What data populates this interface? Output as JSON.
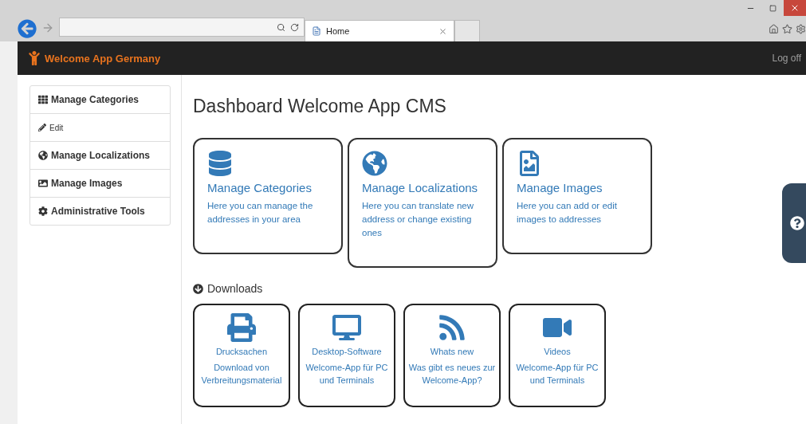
{
  "browser": {
    "tab_title": "Home"
  },
  "app": {
    "brand": "Welcome App Germany",
    "logoff": "Log off"
  },
  "sidebar": {
    "items": [
      {
        "label": "Manage Categories",
        "kind": "main"
      },
      {
        "label": "Edit",
        "kind": "sub"
      },
      {
        "label": "Manage Localizations",
        "kind": "main"
      },
      {
        "label": "Manage Images",
        "kind": "main"
      },
      {
        "label": "Administrative Tools",
        "kind": "main"
      }
    ]
  },
  "title": "Dashboard Welcome App CMS",
  "cards": [
    {
      "title": "Manage Categories",
      "text": "Here you can manage the addresses in your area"
    },
    {
      "title": "Manage Localizations",
      "text": "Here you can translate new address or change existing ones"
    },
    {
      "title": "Manage Images",
      "text": "Here you can add or edit images to addresses"
    }
  ],
  "downloads": {
    "heading": "Downloads",
    "items": [
      {
        "title": "Drucksachen",
        "text": "Download von Verbreitungsmaterial"
      },
      {
        "title": "Desktop-Software",
        "text": "Welcome-App für PC und Terminals"
      },
      {
        "title": "Whats new",
        "text": "Was gibt es neues zur Welcome-App?"
      },
      {
        "title": "Videos",
        "text": "Welcome-App für PC und Terminals"
      }
    ]
  }
}
